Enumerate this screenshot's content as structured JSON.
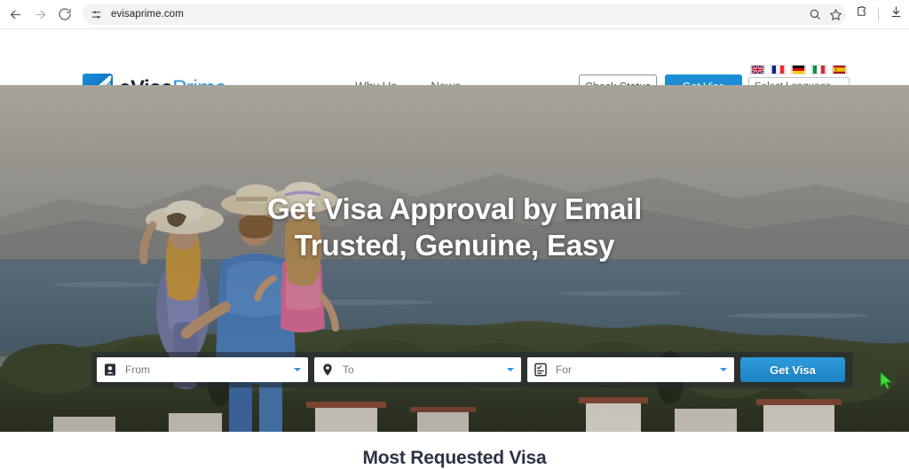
{
  "browser": {
    "back_icon": "back-arrow-icon",
    "forward_icon": "forward-arrow-icon",
    "reload_icon": "reload-icon",
    "site_settings_icon": "tune-sliders-icon",
    "url": "evisaprime.com",
    "omnibox_search_icon": "search-icon",
    "bookmark_icon": "star-icon",
    "extensions_icon": "extensions-puzzle-icon",
    "download_icon": "download-icon"
  },
  "header": {
    "logo": {
      "part1": "eVisa",
      "part2": "Prime",
      "mark_icon": "evisaprime-logo-icon"
    },
    "nav": [
      {
        "label": "Why Us"
      },
      {
        "label": "News"
      }
    ],
    "check_status_label": "Check Status",
    "get_visa_label": "Get Visa",
    "flags": [
      {
        "name": "flag-uk",
        "alt": "United Kingdom"
      },
      {
        "name": "flag-france",
        "alt": "France"
      },
      {
        "name": "flag-germany",
        "alt": "Germany"
      },
      {
        "name": "flag-italy",
        "alt": "Italy"
      },
      {
        "name": "flag-spain",
        "alt": "Spain"
      }
    ],
    "language_select": {
      "value": "Select Language",
      "caret_icon": "chevron-down-icon"
    }
  },
  "hero": {
    "title_line1": "Get Visa Approval by Email",
    "title_line2": "Trusted, Genuine, Easy",
    "search": {
      "from": {
        "placeholder": "From",
        "icon": "passport-icon",
        "caret_icon": "chevron-down-icon"
      },
      "to": {
        "placeholder": "To",
        "icon": "location-pin-icon",
        "caret_icon": "chevron-down-icon"
      },
      "for": {
        "placeholder": "For",
        "icon": "checklist-icon",
        "caret_icon": "chevron-down-icon"
      },
      "submit_label": "Get Visa"
    },
    "cursor_icon": "mouse-cursor-icon"
  },
  "below": {
    "section_title": "Most Requested Visa"
  },
  "colors": {
    "brand_blue": "#1b8ed6",
    "logo_dark": "#16263c",
    "logo_light": "#2f93dd",
    "heading_dark": "#2a3442",
    "cursor_green": "#3ddc3d"
  }
}
